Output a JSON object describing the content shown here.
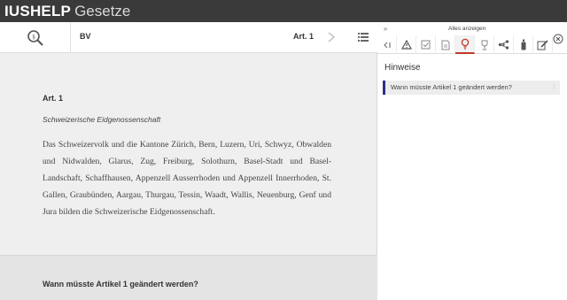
{
  "app": {
    "brand_bold": "IUSHELP",
    "brand_light": "Gesetze"
  },
  "toolbar": {
    "law": "BV",
    "article": "Art. 1",
    "icons": [
      "search-icon",
      "chevron-right-icon",
      "list-icon"
    ]
  },
  "article": {
    "title": "Art. 1",
    "subtitle": "Schweizerische Eidgenossenschaft",
    "text": "Das Schweizervolk und die Kantone Zürich, Bern, Luzern, Uri, Schwyz, Obwalden und Nidwalden, Glarus, Zug, Freiburg, Solothurn, Basel-Stadt und Basel-Landschaft, Schaffhausen, Appenzell Ausserrhoden und Appenzell Innerrhoden, St. Gallen, Graubünden, Aargau, Thurgau, Tessin, Waadt, Wallis, Neuenburg, Genf und Jura bilden die Schweizerische Eidgenossenschaft."
  },
  "question_panel": {
    "question": "Wann müsste Artikel 1 geändert werden?"
  },
  "sidebar": {
    "expand_label": "»",
    "show_all": "Alles anzeigen",
    "tabs": [
      {
        "icon": "collapse-arrow-icon"
      },
      {
        "icon": "warning-icon"
      },
      {
        "icon": "checklist-icon"
      },
      {
        "icon": "document-icon"
      },
      {
        "icon": "lightbulb-icon",
        "active": true
      },
      {
        "icon": "trophy-icon"
      },
      {
        "icon": "network-icon"
      },
      {
        "icon": "bottle-icon"
      },
      {
        "icon": "edit-icon"
      }
    ],
    "hints_title": "Hinweise",
    "hints": [
      {
        "label": "Wann müsste Artikel 1 geändert werden?"
      }
    ]
  },
  "colors": {
    "topbar": "#3a3a3a",
    "active_tab_accent": "#c0392b",
    "hint_marker": "#2b2f8a"
  }
}
